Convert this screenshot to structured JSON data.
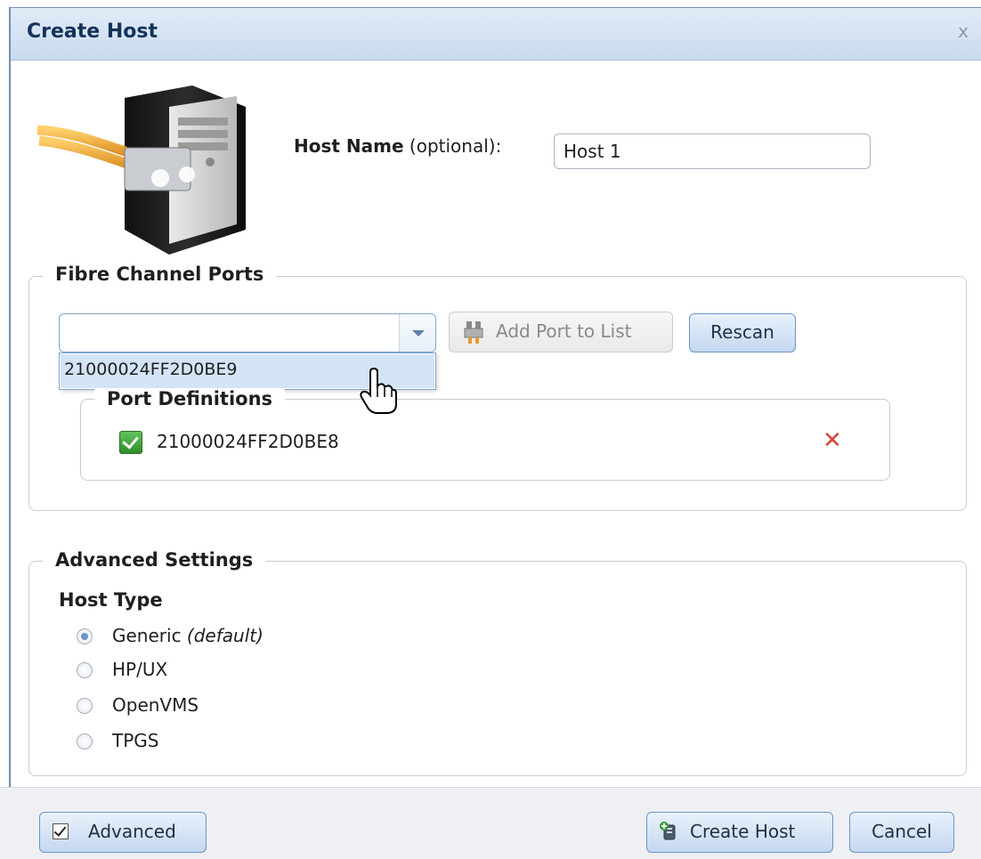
{
  "dialog": {
    "title": "Create Host",
    "close_label": "x"
  },
  "host": {
    "name_label": "Host Name",
    "name_optional": "(optional):",
    "name_value": "Host 1"
  },
  "fc_ports": {
    "legend": "Fibre Channel Ports",
    "combo_value": "",
    "dropdown_option": "21000024FF2D0BE9",
    "add_port_label": "Add Port to List",
    "rescan_label": "Rescan",
    "port_definitions_legend": "Port Definitions",
    "defined_ports": [
      {
        "wwpn": "21000024FF2D0BE8"
      }
    ]
  },
  "advanced": {
    "legend": "Advanced Settings",
    "host_type_label": "Host Type",
    "options": [
      {
        "label": "Generic",
        "note": "(default)",
        "selected": true
      },
      {
        "label": "HP/UX",
        "note": "",
        "selected": false
      },
      {
        "label": "OpenVMS",
        "note": "",
        "selected": false
      },
      {
        "label": "TPGS",
        "note": "",
        "selected": false
      }
    ]
  },
  "footer": {
    "advanced_label": "Advanced",
    "advanced_checked": true,
    "create_label": "Create Host",
    "cancel_label": "Cancel"
  },
  "colors": {
    "title_bar": "#c9daee",
    "button_blue": "#c4d8f0",
    "selected_option": "#d3e4f6",
    "remove": "#d9433a",
    "check_green": "#3fa13a"
  }
}
